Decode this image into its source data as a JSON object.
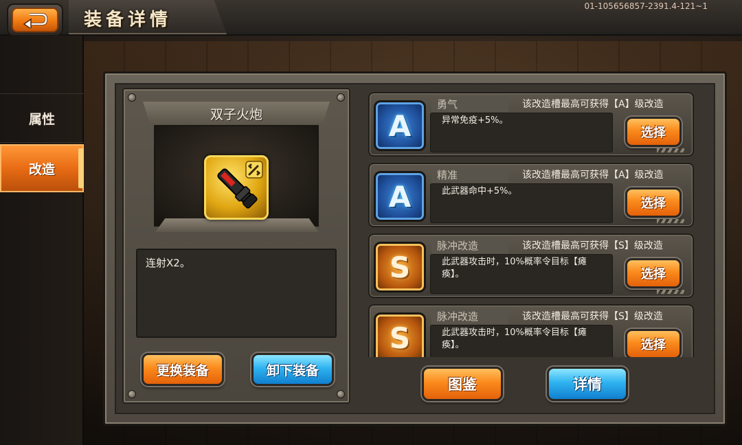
{
  "header": {
    "title": "装备详情",
    "build_id": "01-105656857-2391.4-121~1"
  },
  "sidebar": {
    "tabs": [
      {
        "label": "属性",
        "active": false
      },
      {
        "label": "改造",
        "active": true
      }
    ]
  },
  "weapon": {
    "name": "双子火炮",
    "icon": "cannon-icon",
    "description": "连射X2。",
    "buttons": {
      "replace_label": "更换装备",
      "unequip_label": "卸下装备"
    }
  },
  "slots": [
    {
      "grade": "A",
      "name": "勇气",
      "max_text": "该改造槽最高可获得【A】级改造",
      "effect": "异常免疫+5%。",
      "select_label": "选择"
    },
    {
      "grade": "A",
      "name": "精准",
      "max_text": "该改造槽最高可获得【A】级改造",
      "effect": "此武器命中+5%。",
      "select_label": "选择"
    },
    {
      "grade": "S",
      "name": "脉冲改造",
      "max_text": "该改造槽最高可获得【S】级改造",
      "effect": "此武器攻击时，10%概率令目标【瘫痪】。",
      "select_label": "选择"
    },
    {
      "grade": "S",
      "name": "脉冲改造",
      "max_text": "该改造槽最高可获得【S】级改造",
      "effect": "此武器攻击时，10%概率令目标【瘫痪】。",
      "select_label": "选择"
    }
  ],
  "footer": {
    "codex_label": "图鉴",
    "details_label": "详情"
  },
  "colors": {
    "accent_orange": "#f07a12",
    "accent_blue": "#2fb3f0",
    "grade_a": "#1f4f9a",
    "grade_s": "#b8580e"
  }
}
